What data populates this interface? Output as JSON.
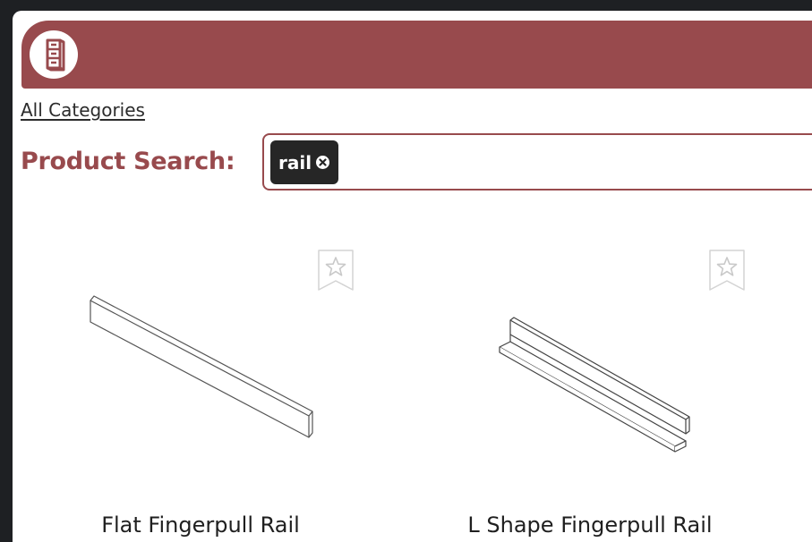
{
  "header": {
    "logo_icon": "file-cabinet-icon",
    "brand_color": "#984a4d"
  },
  "breadcrumb": {
    "label": "All Categories"
  },
  "search": {
    "label": "Product Search:",
    "chips": [
      {
        "label": "rail",
        "remove_icon": "close-circle-icon"
      }
    ]
  },
  "products": [
    {
      "name": "Flat Fingerpull Rail",
      "image_icon": "flat-rail-icon",
      "favorite_icon": "star-bookmark-icon"
    },
    {
      "name": "L Shape Fingerpull Rail",
      "image_icon": "l-shape-rail-icon",
      "favorite_icon": "star-bookmark-icon"
    }
  ]
}
